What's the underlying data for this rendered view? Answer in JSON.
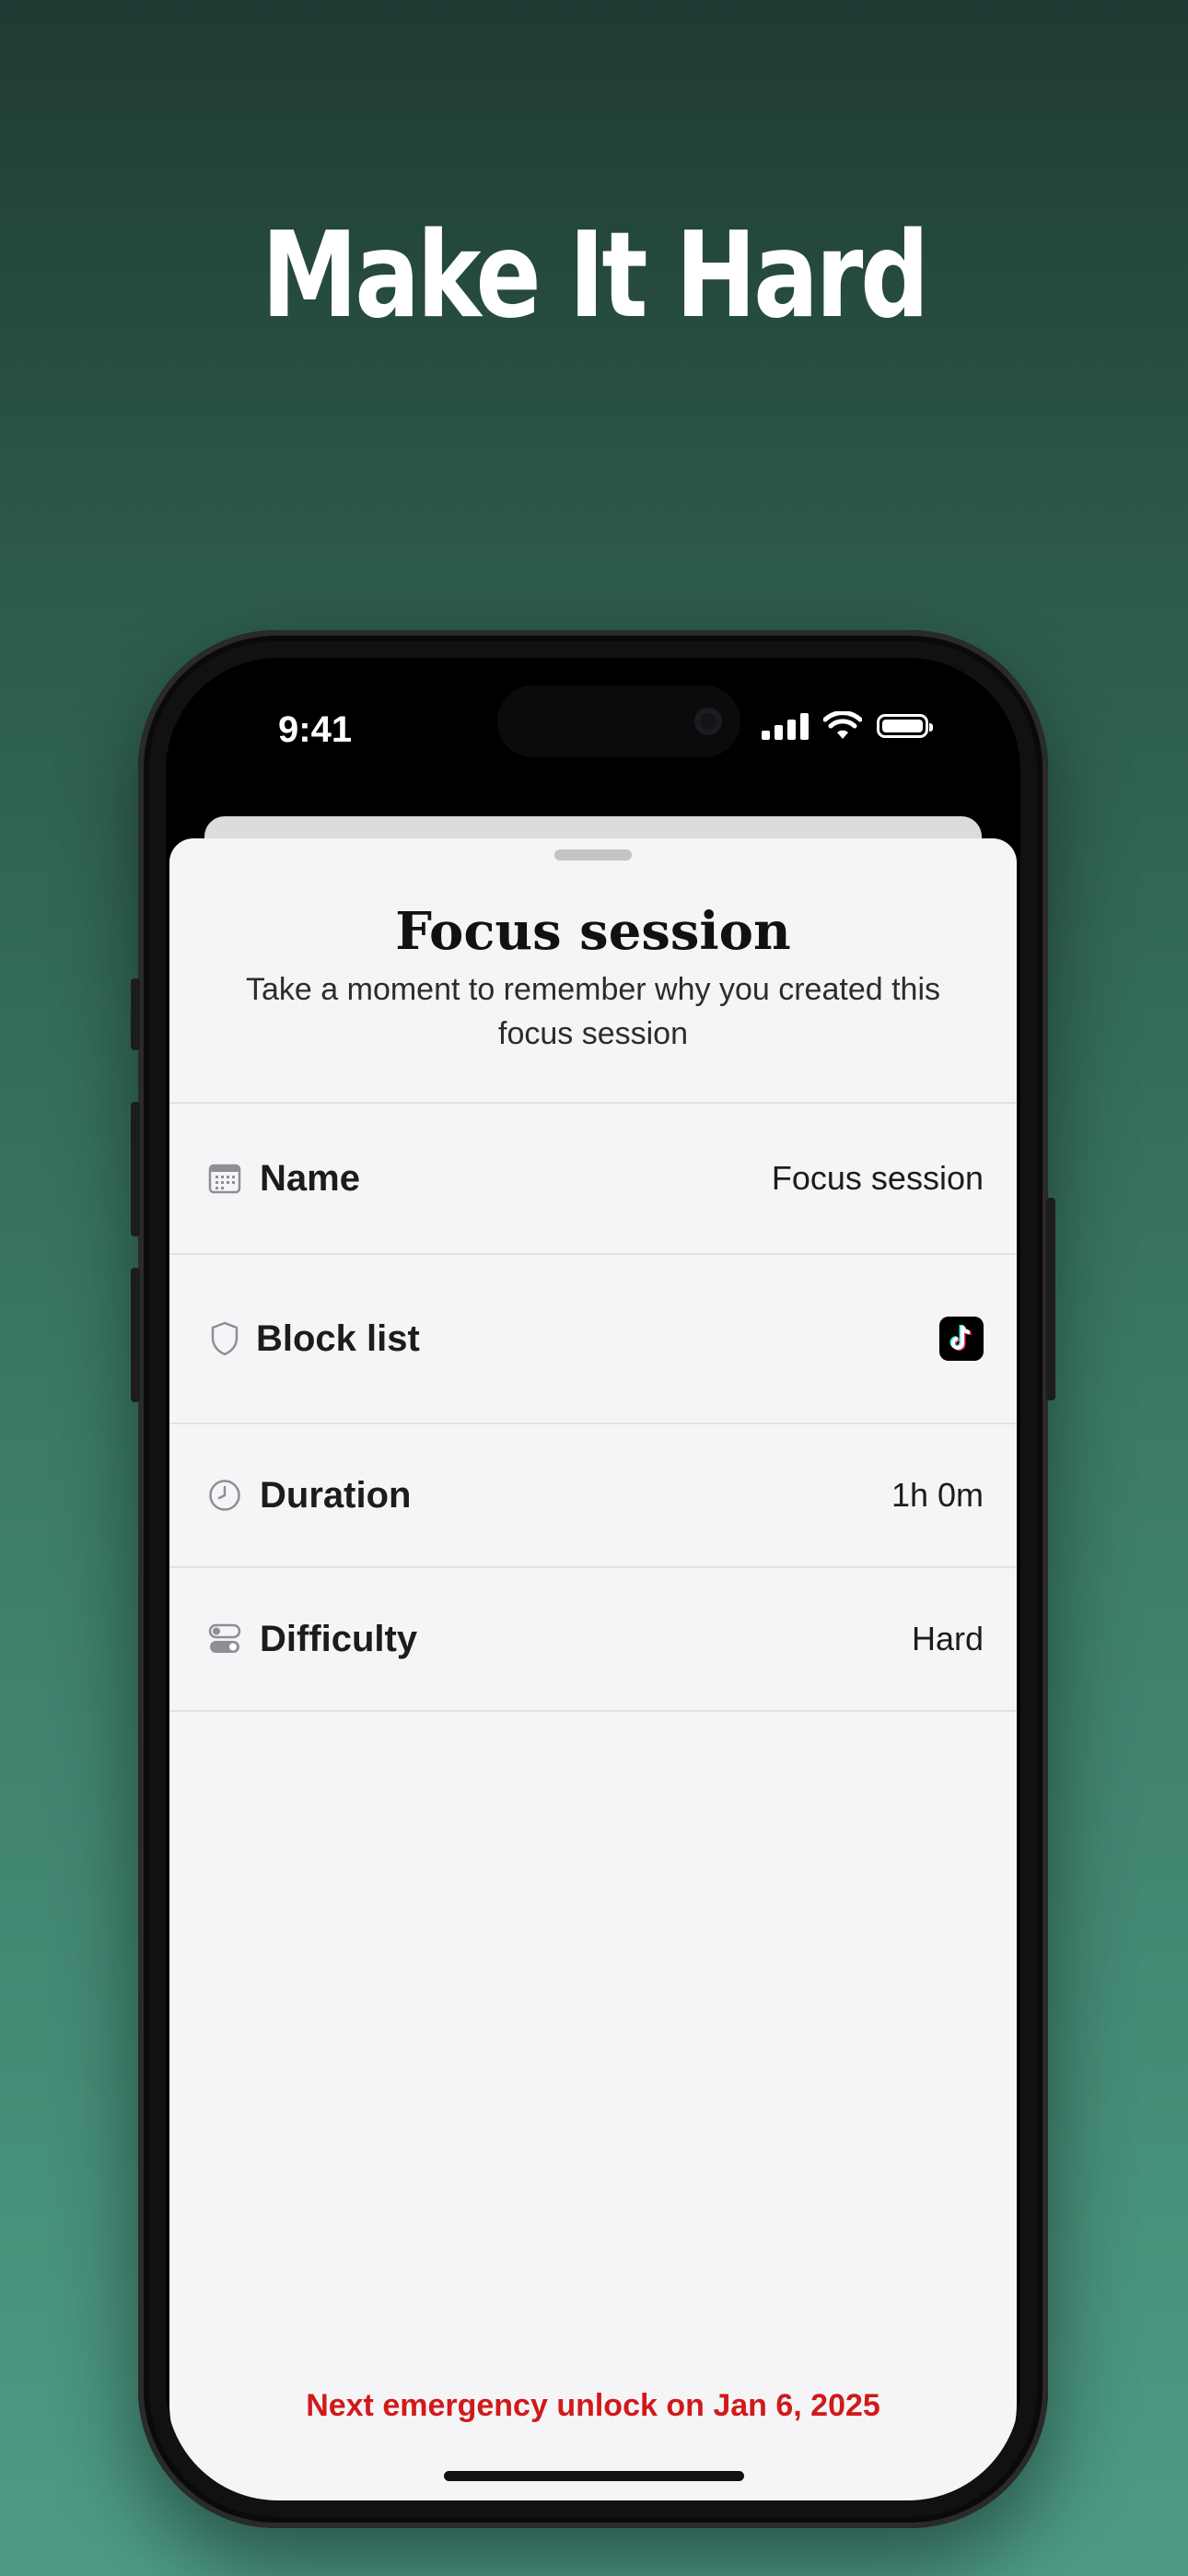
{
  "headline": "Make It Hard",
  "status_bar": {
    "time": "9:41"
  },
  "sheet": {
    "title": "Focus session",
    "subtitle": "Take a moment to remember why you created this focus session",
    "rows": [
      {
        "icon": "calendar-icon",
        "label": "Name",
        "value": "Focus session"
      },
      {
        "icon": "shield-icon",
        "label": "Block list",
        "value_icon": "tiktok-app-icon"
      },
      {
        "icon": "clock-icon",
        "label": "Duration",
        "value": "1h 0m"
      },
      {
        "icon": "toggle-icon",
        "label": "Difficulty",
        "value": "Hard"
      }
    ],
    "emergency_notice": "Next emergency unlock on Jan 6, 2025"
  },
  "colors": {
    "background_top": "#1f3a33",
    "background_bottom": "#4d9b85",
    "sheet_bg": "#f5f5f7",
    "warning_red": "#d01a1a"
  }
}
